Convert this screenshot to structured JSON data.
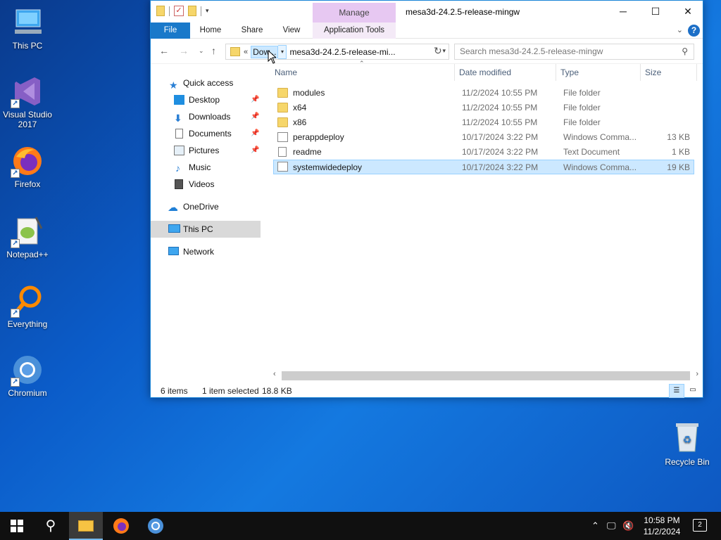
{
  "desktop": {
    "icons": [
      {
        "label": "This PC"
      },
      {
        "label": "Visual Studio 2017"
      },
      {
        "label": "Firefox"
      },
      {
        "label": "Notepad++"
      },
      {
        "label": "Everything"
      },
      {
        "label": "Chromium"
      }
    ],
    "recycle_bin": "Recycle Bin"
  },
  "window": {
    "title": "mesa3d-24.2.5-release-mingw",
    "contextual_tab": "Manage",
    "tabs": [
      "File",
      "Home",
      "Share",
      "View",
      "Application Tools"
    ],
    "address": {
      "prev_marker": "«",
      "highlighted_crumb": "Dow...",
      "current_crumb": "mesa3d-24.2.5-release-mi..."
    },
    "search_placeholder": "Search mesa3d-24.2.5-release-mingw",
    "nav": {
      "quick_access": "Quick access",
      "desktop": "Desktop",
      "downloads": "Downloads",
      "documents": "Documents",
      "pictures": "Pictures",
      "music": "Music",
      "videos": "Videos",
      "onedrive": "OneDrive",
      "this_pc": "This PC",
      "network": "Network"
    },
    "columns": {
      "name": "Name",
      "date": "Date modified",
      "type": "Type",
      "size": "Size"
    },
    "files": [
      {
        "name": "modules",
        "date": "11/2/2024 10:55 PM",
        "type": "File folder",
        "size": ""
      },
      {
        "name": "x64",
        "date": "11/2/2024 10:55 PM",
        "type": "File folder",
        "size": ""
      },
      {
        "name": "x86",
        "date": "11/2/2024 10:55 PM",
        "type": "File folder",
        "size": ""
      },
      {
        "name": "perappdeploy",
        "date": "10/17/2024 3:22 PM",
        "type": "Windows Comma...",
        "size": "13 KB"
      },
      {
        "name": "readme",
        "date": "10/17/2024 3:22 PM",
        "type": "Text Document",
        "size": "1 KB"
      },
      {
        "name": "systemwidedeploy",
        "date": "10/17/2024 3:22 PM",
        "type": "Windows Comma...",
        "size": "19 KB"
      }
    ],
    "status": {
      "items": "6 items",
      "selected": "1 item selected",
      "size": "18.8 KB"
    }
  },
  "taskbar": {
    "time": "10:58 PM",
    "date": "11/2/2024",
    "notifications": "2"
  }
}
